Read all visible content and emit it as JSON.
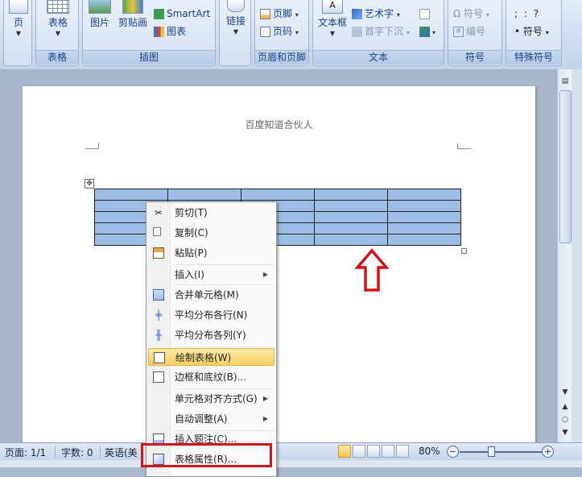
{
  "ribbon": {
    "groups": {
      "pages": {
        "btn_label": "页"
      },
      "table": {
        "btn_label": "表格",
        "group_label": "表格"
      },
      "illustrations": {
        "picture": "图片",
        "clipart": "剪贴画",
        "smartart": "SmartArt",
        "chart": "图表",
        "group_label": "插图"
      },
      "links": {
        "btn_label": "链接"
      },
      "header_footer": {
        "footer": "页脚",
        "page_number": "页码",
        "group_label": "页眉和页脚"
      },
      "text": {
        "textbox": "文本框",
        "wordart": "艺术字",
        "dropcap": "首字下沉",
        "group_label": "文本"
      },
      "symbols": {
        "symbol": "符号",
        "number": "编号",
        "group_label": "符号"
      },
      "special_symbols": {
        "symbol": "符号",
        "row1": ";  :  ?",
        "group_label": "特殊符号"
      }
    }
  },
  "document": {
    "header_text": "百度知道合伙人",
    "table": {
      "rows": 5,
      "cols": 5
    }
  },
  "context_menu": {
    "items": [
      {
        "label": "剪切(T)",
        "icon": "scissors-icon"
      },
      {
        "label": "复制(C)",
        "icon": "copy-icon"
      },
      {
        "label": "粘贴(P)",
        "icon": "paste-icon"
      },
      {
        "label": "插入(I)",
        "icon": "",
        "submenu": true
      },
      {
        "label": "合并单元格(M)",
        "icon": "merge-cells-icon"
      },
      {
        "label": "平均分布各行(N)",
        "icon": "distribute-rows-icon"
      },
      {
        "label": "平均分布各列(Y)",
        "icon": "distribute-columns-icon"
      },
      {
        "label": "绘制表格(W)",
        "icon": "draw-table-icon",
        "highlighted": true
      },
      {
        "label": "边框和底纹(B)...",
        "icon": "borders-icon"
      },
      {
        "label": "单元格对齐方式(G)",
        "icon": "",
        "submenu": true
      },
      {
        "label": "自动调整(A)",
        "icon": "",
        "submenu": true
      },
      {
        "label": "插入题注(C)...",
        "icon": "caption-icon"
      },
      {
        "label": "表格属性(R)...",
        "icon": "table-properties-icon"
      }
    ]
  },
  "status_bar": {
    "page": "页面: 1/1",
    "words": "字数: 0",
    "language": "英语(美",
    "zoom": "80%"
  },
  "colors": {
    "annotation_red": "#d1141b",
    "selection_blue": "#9dbde6"
  }
}
